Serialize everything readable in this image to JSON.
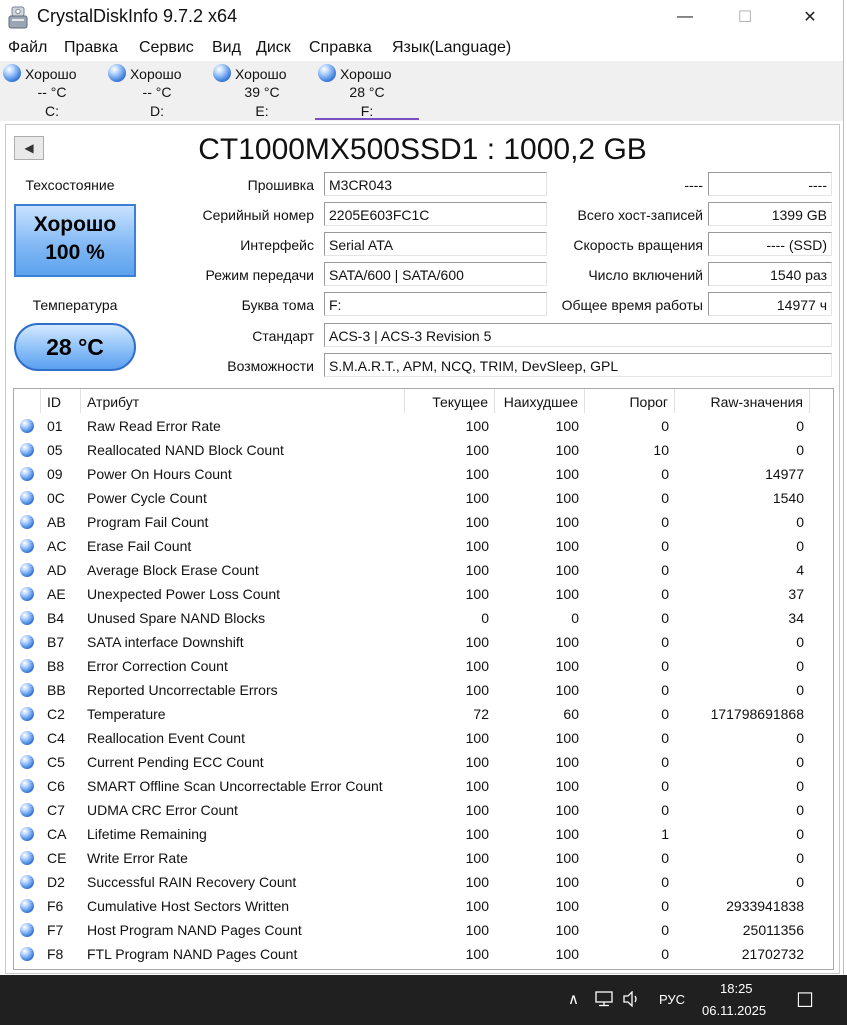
{
  "window": {
    "title": "CrystalDiskInfo 9.7.2 x64",
    "min_glyph": "—",
    "max_glyph": "☐",
    "close_glyph": "✕"
  },
  "menu": [
    "Файл",
    "Правка",
    "Сервис",
    "Вид",
    "Диск",
    "Справка",
    "Язык(Language)"
  ],
  "drives": [
    {
      "status": "Хорошо",
      "temp": "-- °C",
      "letter": "C:"
    },
    {
      "status": "Хорошо",
      "temp": "-- °C",
      "letter": "D:"
    },
    {
      "status": "Хорошо",
      "temp": "39 °C",
      "letter": "E:"
    },
    {
      "status": "Хорошо",
      "temp": "28 °C",
      "letter": "F:"
    }
  ],
  "disk": {
    "back_glyph": "◀",
    "model": "CT1000MX500SSD1 : 1000,2 GB",
    "health_label": "Техсостояние",
    "health_status": "Хорошо",
    "health_percent": "100 %",
    "temp_label": "Температура",
    "temp_value": "28 °C",
    "labels": {
      "firmware": "Прошивка",
      "serial": "Серийный номер",
      "interface": "Интерфейс",
      "transfer": "Режим передачи",
      "letter": "Буква тома",
      "standard": "Стандарт",
      "features": "Возможности",
      "blank_left": "----",
      "host_writes": "Всего хост-записей",
      "rotation": "Скорость вращения",
      "power_count": "Число включений",
      "power_hours": "Общее время работы"
    },
    "values": {
      "firmware": "M3CR043",
      "serial": "2205E603FC1C",
      "interface": "Serial ATA",
      "transfer": "SATA/600 | SATA/600",
      "letter": "F:",
      "standard": "ACS-3 | ACS-3 Revision 5",
      "features": "S.M.A.R.T., APM, NCQ, TRIM, DevSleep, GPL",
      "blank_right": "----",
      "host_writes": "1399 GB",
      "rotation": "---- (SSD)",
      "power_count": "1540 раз",
      "power_hours": "14977 ч"
    }
  },
  "smart": {
    "headers": {
      "id": "ID",
      "attr": "Атрибут",
      "current": "Текущее",
      "worst": "Наихудшее",
      "threshold": "Порог",
      "raw": "Raw-значения"
    },
    "rows": [
      {
        "id": "01",
        "name": "Raw Read Error Rate",
        "current": "100",
        "worst": "100",
        "threshold": "0",
        "raw": "0"
      },
      {
        "id": "05",
        "name": "Reallocated NAND Block Count",
        "current": "100",
        "worst": "100",
        "threshold": "10",
        "raw": "0"
      },
      {
        "id": "09",
        "name": "Power On Hours Count",
        "current": "100",
        "worst": "100",
        "threshold": "0",
        "raw": "14977"
      },
      {
        "id": "0C",
        "name": "Power Cycle Count",
        "current": "100",
        "worst": "100",
        "threshold": "0",
        "raw": "1540"
      },
      {
        "id": "AB",
        "name": "Program Fail Count",
        "current": "100",
        "worst": "100",
        "threshold": "0",
        "raw": "0"
      },
      {
        "id": "AC",
        "name": "Erase Fail Count",
        "current": "100",
        "worst": "100",
        "threshold": "0",
        "raw": "0"
      },
      {
        "id": "AD",
        "name": "Average Block Erase Count",
        "current": "100",
        "worst": "100",
        "threshold": "0",
        "raw": "4"
      },
      {
        "id": "AE",
        "name": "Unexpected Power Loss Count",
        "current": "100",
        "worst": "100",
        "threshold": "0",
        "raw": "37"
      },
      {
        "id": "B4",
        "name": "Unused Spare NAND Blocks",
        "current": "0",
        "worst": "0",
        "threshold": "0",
        "raw": "34"
      },
      {
        "id": "B7",
        "name": "SATA interface Downshift",
        "current": "100",
        "worst": "100",
        "threshold": "0",
        "raw": "0"
      },
      {
        "id": "B8",
        "name": "Error Correction Count",
        "current": "100",
        "worst": "100",
        "threshold": "0",
        "raw": "0"
      },
      {
        "id": "BB",
        "name": "Reported Uncorrectable Errors",
        "current": "100",
        "worst": "100",
        "threshold": "0",
        "raw": "0"
      },
      {
        "id": "C2",
        "name": "Temperature",
        "current": "72",
        "worst": "60",
        "threshold": "0",
        "raw": "171798691868"
      },
      {
        "id": "C4",
        "name": "Reallocation Event Count",
        "current": "100",
        "worst": "100",
        "threshold": "0",
        "raw": "0"
      },
      {
        "id": "C5",
        "name": "Current Pending ECC Count",
        "current": "100",
        "worst": "100",
        "threshold": "0",
        "raw": "0"
      },
      {
        "id": "C6",
        "name": "SMART Offline Scan Uncorrectable Error Count",
        "current": "100",
        "worst": "100",
        "threshold": "0",
        "raw": "0"
      },
      {
        "id": "C7",
        "name": "UDMA CRC Error Count",
        "current": "100",
        "worst": "100",
        "threshold": "0",
        "raw": "0"
      },
      {
        "id": "CA",
        "name": "Lifetime Remaining",
        "current": "100",
        "worst": "100",
        "threshold": "1",
        "raw": "0"
      },
      {
        "id": "CE",
        "name": "Write Error Rate",
        "current": "100",
        "worst": "100",
        "threshold": "0",
        "raw": "0"
      },
      {
        "id": "D2",
        "name": "Successful RAIN Recovery Count",
        "current": "100",
        "worst": "100",
        "threshold": "0",
        "raw": "0"
      },
      {
        "id": "F6",
        "name": "Cumulative Host Sectors Written",
        "current": "100",
        "worst": "100",
        "threshold": "0",
        "raw": "2933941838"
      },
      {
        "id": "F7",
        "name": "Host Program NAND Pages Count",
        "current": "100",
        "worst": "100",
        "threshold": "0",
        "raw": "25011356"
      },
      {
        "id": "F8",
        "name": "FTL Program NAND Pages Count",
        "current": "100",
        "worst": "100",
        "threshold": "0",
        "raw": "21702732"
      }
    ]
  },
  "taskbar": {
    "chevron": "∧",
    "lang": "РУС",
    "time": "18:25",
    "date": "06.11.2025",
    "notification_glyph": "☐"
  }
}
